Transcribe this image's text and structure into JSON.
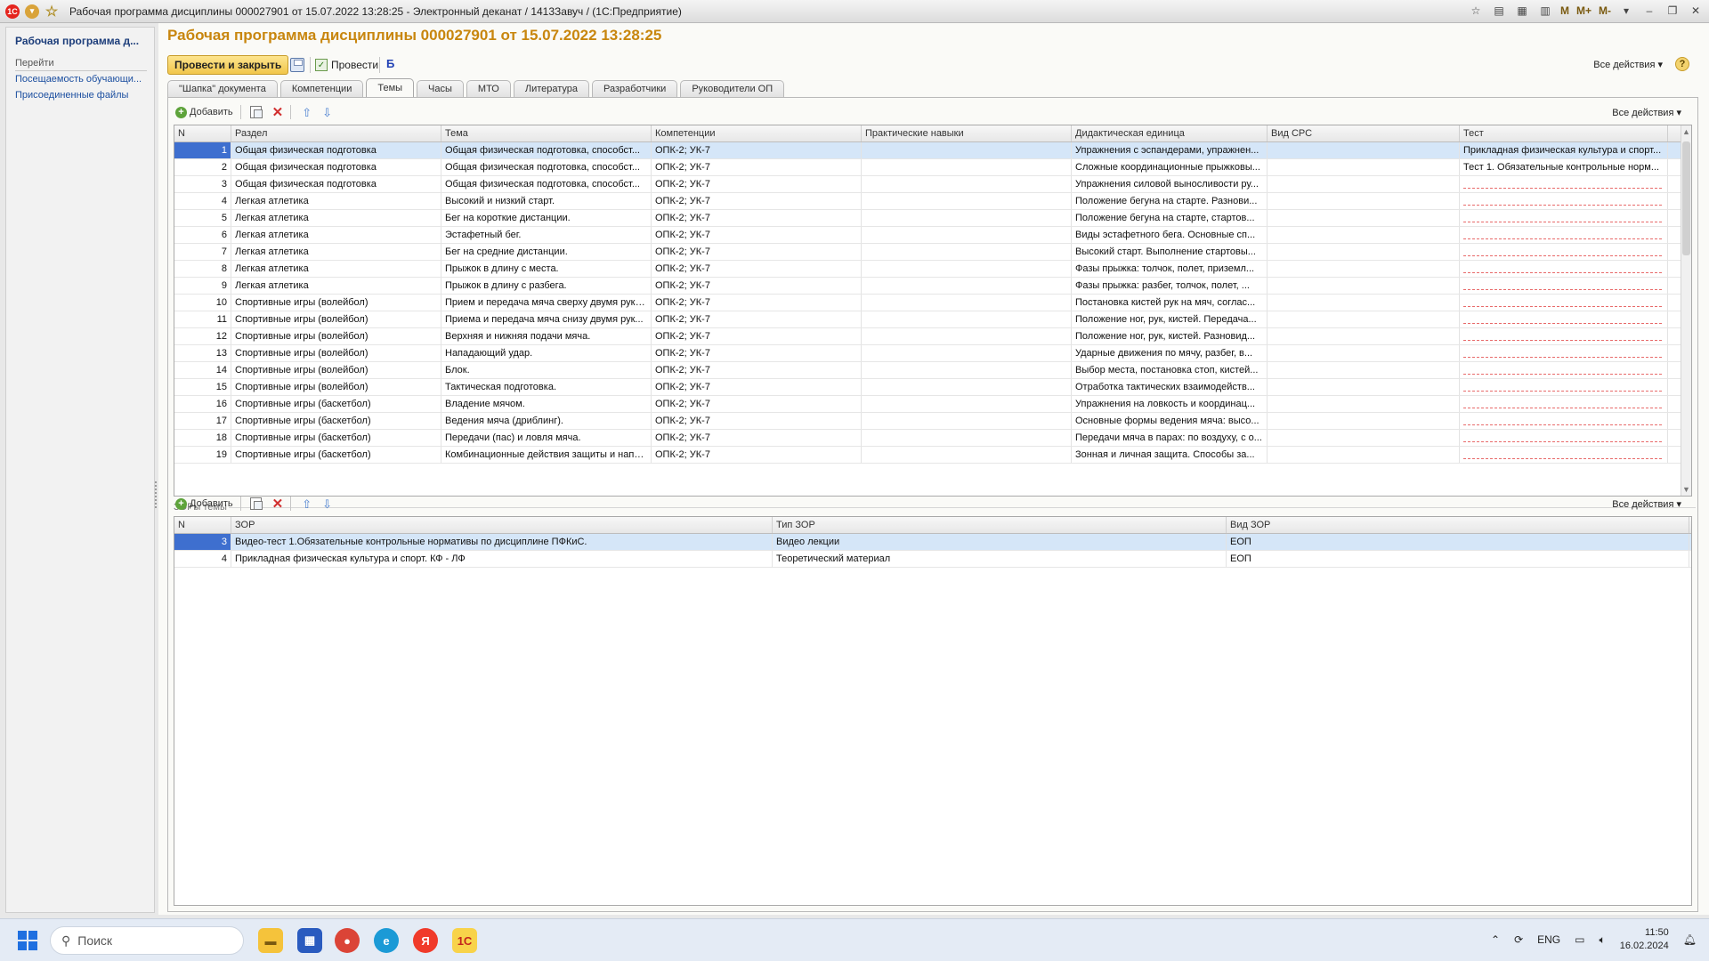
{
  "window": {
    "title": "Рабочая программа дисциплины 000027901 от 15.07.2022 13:28:25 - Электронный деканат / 1413Завуч /  (1С:Предприятие)",
    "m_buttons": [
      "M",
      "M+",
      "M-"
    ]
  },
  "nav": {
    "doc_title": "Рабочая программа д...",
    "goto_label": "Перейти",
    "links": [
      "Посещаемость обучающи...",
      "Присоединенные файлы"
    ]
  },
  "form": {
    "title": "Рабочая программа дисциплины 000027901 от 15.07.2022 13:28:25",
    "post_close": "Провести и закрыть",
    "post": "Провести",
    "all_actions": "Все действия",
    "help": "?"
  },
  "tabs": [
    "\"Шапка\" документа",
    "Компетенции",
    "Темы",
    "Часы",
    "МТО",
    "Литература",
    "Разработчики",
    "Руководители ОП"
  ],
  "active_tab": 2,
  "toolbar": {
    "add": "Добавить",
    "all_actions": "Все действия"
  },
  "themes_table": {
    "columns": [
      "N",
      "Раздел",
      "Тема",
      "Компетенции",
      "Практические навыки",
      "Дидактическая единица",
      "Вид СРС",
      "Тест"
    ],
    "rows": [
      [
        "1",
        "Общая физическая подготовка",
        "Общая физическая подготовка, способст...",
        "ОПК-2; УК-7",
        "",
        "Упражнения с эспандерами, упражнен...",
        "",
        "Прикладная физическая культура и спорт..."
      ],
      [
        "2",
        "Общая физическая подготовка",
        "Общая физическая подготовка, способст...",
        "ОПК-2; УК-7",
        "",
        "Сложные координационные прыжковы...",
        "",
        "Тест 1. Обязательные контрольные норм..."
      ],
      [
        "3",
        "Общая физическая подготовка",
        "Общая физическая подготовка, способст...",
        "ОПК-2; УК-7",
        "",
        "Упражнения силовой выносливости ру...",
        "",
        ""
      ],
      [
        "4",
        "Легкая атлетика",
        "Высокий и низкий старт.",
        "ОПК-2; УК-7",
        "",
        "Положение бегуна на старте. Разнови...",
        "",
        ""
      ],
      [
        "5",
        "Легкая атлетика",
        "Бег на короткие дистанции.",
        "ОПК-2; УК-7",
        "",
        "Положение бегуна на старте, стартов...",
        "",
        ""
      ],
      [
        "6",
        "Легкая атлетика",
        "Эстафетный бег.",
        "ОПК-2; УК-7",
        "",
        "Виды эстафетного бега. Основные сп...",
        "",
        ""
      ],
      [
        "7",
        "Легкая атлетика",
        "Бег на средние дистанции.",
        "ОПК-2; УК-7",
        "",
        "Высокий старт. Выполнение стартовы...",
        "",
        ""
      ],
      [
        "8",
        "Легкая атлетика",
        "Прыжок в длину с места.",
        "ОПК-2; УК-7",
        "",
        "Фазы прыжка: толчок, полет, приземл...",
        "",
        ""
      ],
      [
        "9",
        "Легкая атлетика",
        "Прыжок в длину с разбега.",
        "ОПК-2; УК-7",
        "",
        "Фазы прыжка: разбег, толчок, полет, ...",
        "",
        ""
      ],
      [
        "10",
        "Спортивные игры (волейбол)",
        "Прием и передача мяча сверху двумя рука...",
        "ОПК-2; УК-7",
        "",
        "Постановка кистей рук на мяч, соглас...",
        "",
        ""
      ],
      [
        "11",
        "Спортивные игры (волейбол)",
        "Приема и передача мяча снизу двумя рук...",
        "ОПК-2; УК-7",
        "",
        "Положение ног, рук, кистей. Передача...",
        "",
        ""
      ],
      [
        "12",
        "Спортивные игры (волейбол)",
        "Верхняя и нижняя подачи мяча.",
        "ОПК-2; УК-7",
        "",
        "Положение ног, рук, кистей. Разновид...",
        "",
        ""
      ],
      [
        "13",
        "Спортивные игры (волейбол)",
        "Нападающий удар.",
        "ОПК-2; УК-7",
        "",
        "Ударные движения по мячу, разбег, в...",
        "",
        ""
      ],
      [
        "14",
        "Спортивные игры (волейбол)",
        "Блок.",
        "ОПК-2; УК-7",
        "",
        "Выбор места, постановка стоп, кистей...",
        "",
        ""
      ],
      [
        "15",
        "Спортивные игры (волейбол)",
        "Тактическая подготовка.",
        "ОПК-2; УК-7",
        "",
        "Отработка тактических взаимодейств...",
        "",
        ""
      ],
      [
        "16",
        "Спортивные игры (баскетбол)",
        "Владение мячом.",
        "ОПК-2; УК-7",
        "",
        "Упражнения на ловкость и координац...",
        "",
        ""
      ],
      [
        "17",
        "Спортивные игры (баскетбол)",
        "Ведения мяча (дриблинг).",
        "ОПК-2; УК-7",
        "",
        "Основные формы ведения мяча: высо...",
        "",
        ""
      ],
      [
        "18",
        "Спортивные игры (баскетбол)",
        "Передачи (пас) и ловля мяча.",
        "ОПК-2; УК-7",
        "",
        "Передачи мяча в парах: по воздуху, с о...",
        "",
        ""
      ],
      [
        "19",
        "Спортивные игры (баскетбол)",
        "Комбинационные действия защиты и напа...",
        "ОПК-2; УК-7",
        "",
        "Зонная и личная защита. Способы за...",
        "",
        ""
      ]
    ]
  },
  "zor": {
    "label": "ЗОРы темы",
    "columns": [
      "N",
      "ЗОР",
      "Тип ЗОР",
      "Вид ЗОР"
    ],
    "rows": [
      [
        "3",
        "Видео-тест 1.Обязательные контрольные нормативы по дисциплине ПФКиС.",
        "Видео лекции",
        "ЕОП"
      ],
      [
        "4",
        "Прикладная физическая культура и спорт. КФ - ЛФ",
        "Теоретический материал",
        "ЕОП"
      ]
    ]
  },
  "taskbar": {
    "search_placeholder": "Поиск",
    "lang": "ENG",
    "time": "11:50",
    "date": "16.02.2024"
  },
  "colors": {
    "accent_title": "#c8860e",
    "selection": "#d5e6f8",
    "selection_num": "#3e6fcf"
  }
}
